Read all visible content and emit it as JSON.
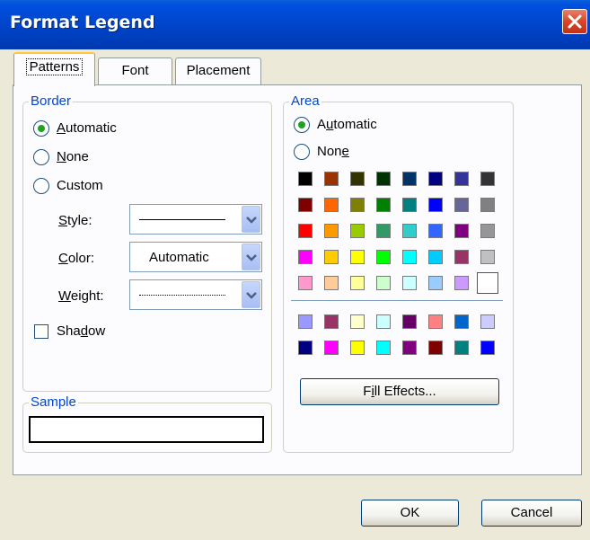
{
  "window": {
    "title": "Format Legend"
  },
  "tabs": [
    {
      "label": "Patterns",
      "active": true
    },
    {
      "label": "Font",
      "active": false
    },
    {
      "label": "Placement",
      "active": false
    }
  ],
  "border": {
    "legend": "Border",
    "options": [
      {
        "label": "Automatic",
        "mnemonic": "A",
        "selected": true
      },
      {
        "label": "None",
        "mnemonic": "N",
        "selected": false
      },
      {
        "label": "Custom",
        "mnemonic": "",
        "selected": false
      }
    ],
    "style_label": "Style:",
    "color_label": "Color:",
    "color_value": "Automatic",
    "weight_label": "Weight:",
    "shadow_label": "Shadow",
    "shadow_checked": false
  },
  "sample": {
    "legend": "Sample"
  },
  "area": {
    "legend": "Area",
    "options": [
      {
        "label": "Automatic",
        "selected": true
      },
      {
        "label": "None",
        "selected": false
      }
    ],
    "palette_main": [
      [
        "#000000",
        "#993300",
        "#333300",
        "#003300",
        "#003366",
        "#000080",
        "#333399",
        "#333333"
      ],
      [
        "#800000",
        "#FF6600",
        "#808000",
        "#008000",
        "#008080",
        "#0000FF",
        "#666699",
        "#808080"
      ],
      [
        "#FF0000",
        "#FF9900",
        "#99CC00",
        "#339966",
        "#33CCCC",
        "#3366FF",
        "#800080",
        "#969696"
      ],
      [
        "#FF00FF",
        "#FFCC00",
        "#FFFF00",
        "#00FF00",
        "#00FFFF",
        "#00CCFF",
        "#993366",
        "#C0C0C0"
      ],
      [
        "#FF99CC",
        "#FFCC99",
        "#FFFF99",
        "#CCFFCC",
        "#CCFFFF",
        "#99CCFF",
        "#CC99FF",
        "#FFFFFF"
      ]
    ],
    "palette_chart": [
      [
        "#9999FF",
        "#993366",
        "#FFFFCC",
        "#CCFFFF",
        "#660066",
        "#FF8080",
        "#0066CC",
        "#CCCCFF"
      ],
      [
        "#000080",
        "#FF00FF",
        "#FFFF00",
        "#00FFFF",
        "#800080",
        "#800000",
        "#008080",
        "#0000FF"
      ]
    ],
    "selected_swatch": "#FFFFFF",
    "fill_effects_label": "Fill Effects..."
  },
  "buttons": {
    "ok": "OK",
    "cancel": "Cancel"
  }
}
